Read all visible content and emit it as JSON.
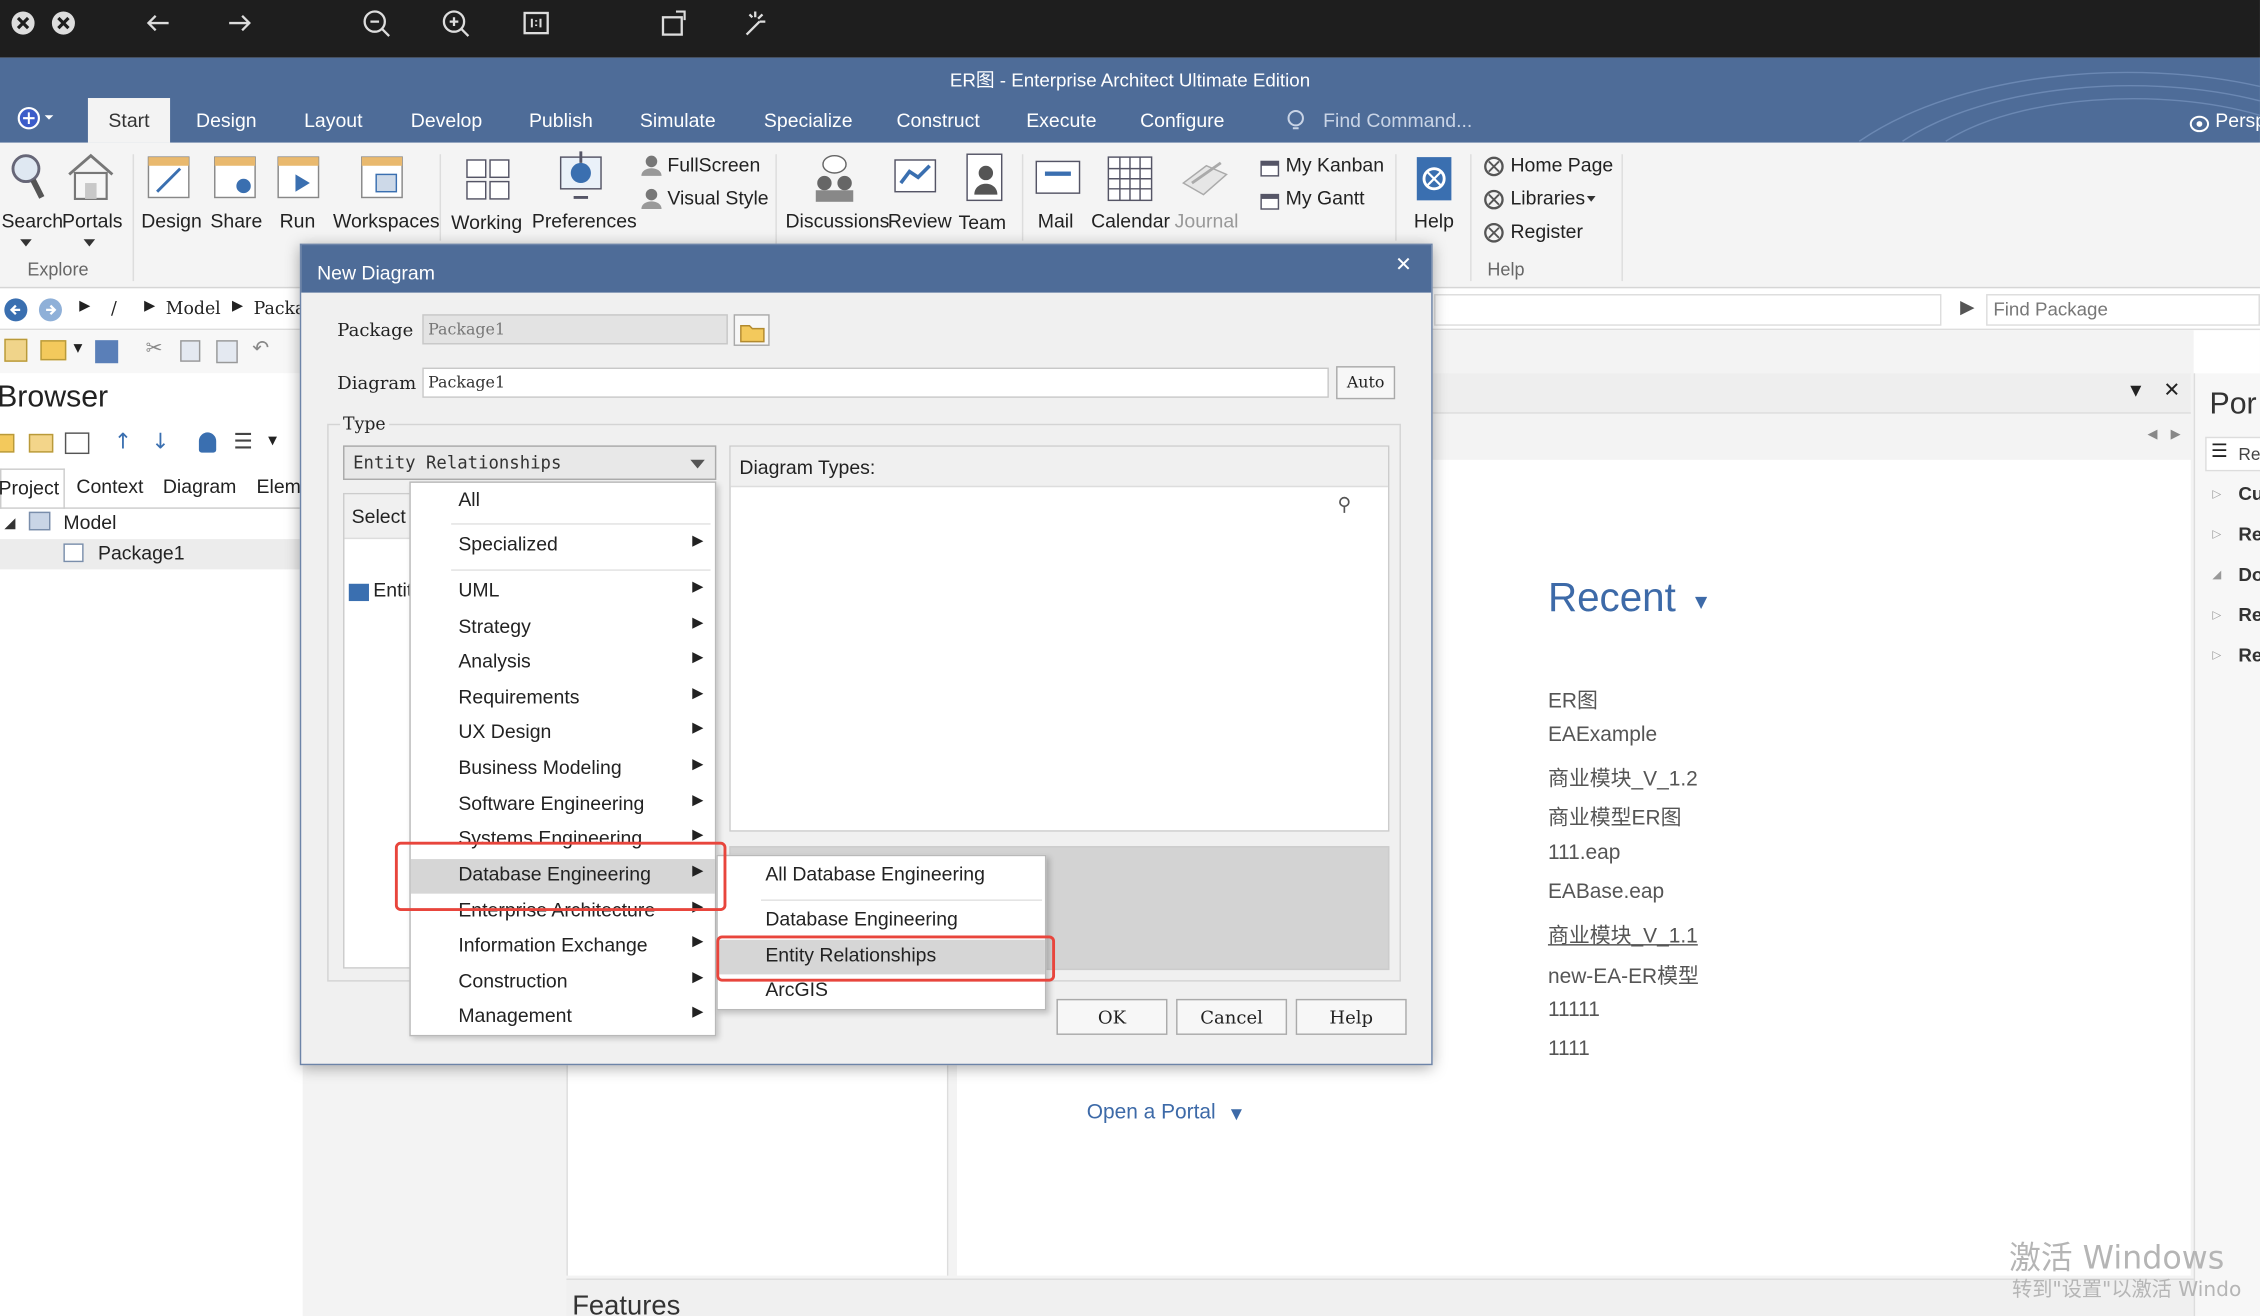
{
  "window": {
    "title": "ER图 - Enterprise Architect Ultimate Edition"
  },
  "ribbon_tabs": [
    "Start",
    "Design",
    "Layout",
    "Develop",
    "Publish",
    "Simulate",
    "Specialize",
    "Construct",
    "Execute",
    "Configure"
  ],
  "find_command": "Find Command...",
  "perspective": "Persp",
  "ribbon": {
    "search": "Search",
    "portals": "Portals",
    "design": "Design",
    "share": "Share",
    "run": "Run",
    "workspaces": "Workspaces",
    "working_sets": "Working Sets",
    "preferences": "Preferences",
    "fullscreen": "FullScreen",
    "visual_style": "Visual Style",
    "discussions": "Discussions",
    "review": "Review",
    "team_library": "Team Library",
    "mail": "Mail",
    "calendar": "Calendar",
    "journal": "Journal",
    "my_kanban": "My Kanban",
    "my_gantt": "My Gantt",
    "help": "Help",
    "home_page": "Home Page",
    "libraries": "Libraries",
    "register": "Register",
    "group_explore": "Explore",
    "group_help": "Help"
  },
  "nav": {
    "root": "/",
    "model": "Model",
    "package": "Packa",
    "find_package": "Find Package"
  },
  "browser": {
    "title": "Browser",
    "tabs": [
      "Project",
      "Context",
      "Diagram",
      "Elem"
    ],
    "tree": [
      {
        "label": "Model"
      },
      {
        "label": "Package1"
      }
    ]
  },
  "portal": {
    "title": "Por",
    "items": [
      "Re",
      "Cu",
      "Re",
      "Do",
      "Re",
      "Re"
    ]
  },
  "dialog": {
    "title": "New Diagram",
    "package_label": "Package",
    "package_value": "Package1",
    "diagram_label": "Diagram",
    "diagram_value": "Package1",
    "auto_button": "Auto",
    "type_label": "Type",
    "type_selected": "Entity Relationships",
    "select_label": "Select",
    "entity_item": "Entit",
    "diagram_types_label": "Diagram Types:",
    "ok": "OK",
    "cancel": "Cancel",
    "help": "Help"
  },
  "menu": {
    "items": [
      {
        "label": "All",
        "arrow": ""
      },
      {
        "label": "Specialized",
        "arrow": "▶"
      },
      {
        "label": "UML",
        "arrow": "▶"
      },
      {
        "label": "Strategy",
        "arrow": "▶"
      },
      {
        "label": "Analysis",
        "arrow": "▶"
      },
      {
        "label": "Requirements",
        "arrow": "▶"
      },
      {
        "label": "UX Design",
        "arrow": "▶"
      },
      {
        "label": "Business Modeling",
        "arrow": "▶"
      },
      {
        "label": "Software Engineering",
        "arrow": "▶"
      },
      {
        "label": "Systems Engineering",
        "arrow": "▶"
      },
      {
        "label": "Database Engineering",
        "arrow": "▶"
      },
      {
        "label": "Enterprise Architecture",
        "arrow": "▶"
      },
      {
        "label": "Information Exchange",
        "arrow": "▶"
      },
      {
        "label": "Construction",
        "arrow": "▶"
      },
      {
        "label": "Management",
        "arrow": "▶"
      }
    ],
    "submenu": [
      "All Database Engineering",
      "Database Engineering",
      "Entity Relationships",
      "ArcGIS"
    ]
  },
  "start_page": {
    "recent_title": "Recent",
    "recent": [
      "ER图",
      "EAExample",
      "商业模块_V_1.2",
      "商业模型ER图",
      "111.eap",
      "EABase.eap",
      "商业模块_V_1.1",
      "new-EA-ER模型",
      "11111",
      "1111"
    ],
    "open_portal": "Open a Portal",
    "features": "Features"
  },
  "watermark": {
    "line1": "激活 Windows",
    "line2": "转到\"设置\"以激活 Windo"
  },
  "colors": {
    "accent": "#4e6c98",
    "highlight": "#e8453c",
    "link": "#3d6aa8"
  }
}
